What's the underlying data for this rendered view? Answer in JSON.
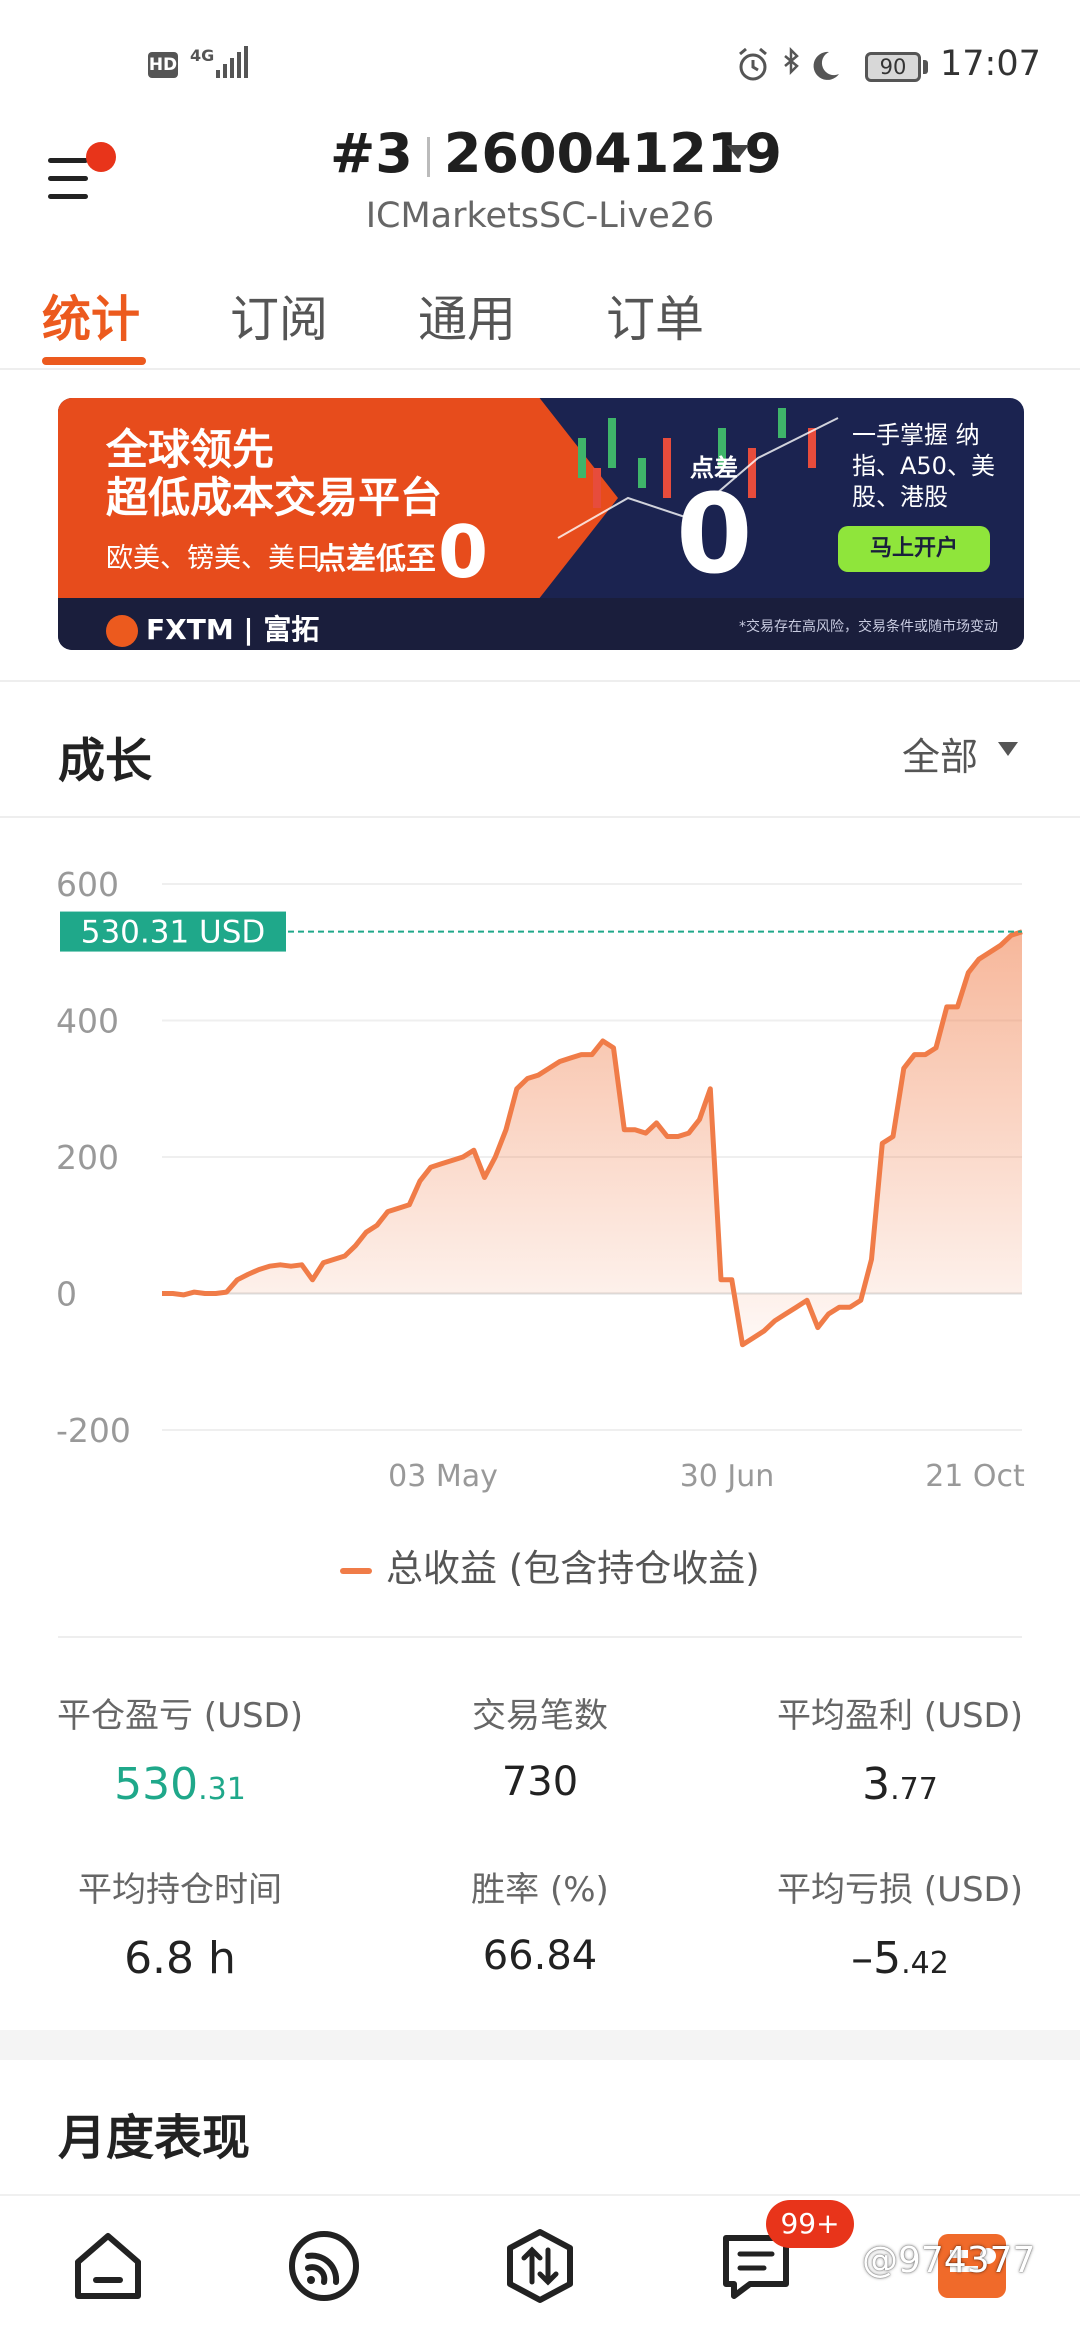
{
  "status_bar": {
    "hd": "HD",
    "network": "4G",
    "battery": "90",
    "time": "17:07"
  },
  "header": {
    "account_rank": "#3",
    "account_number": "260041219",
    "server": "ICMarketsSC-Live26"
  },
  "tabs": [
    {
      "label": "统计",
      "active": true
    },
    {
      "label": "订阅",
      "active": false
    },
    {
      "label": "通用",
      "active": false
    },
    {
      "label": "订单",
      "active": false
    }
  ],
  "banner": {
    "headline1": "全球领先",
    "headline2": "超低成本交易平台",
    "subline": "欧美、镑美、美日",
    "subline2": "点差低至",
    "zero": "0",
    "spread_label": "点差",
    "spread_zero": "0",
    "right_text": "一手掌握 纳指、A50、美股、港股",
    "cta": "马上开户",
    "brand": "FXTM | 富拓",
    "disclaimer": "*交易存在高风险，交易条件或随市场变动",
    "colors": {
      "red": "#e74c1c",
      "navy": "#1b2350",
      "cta": "#8fe53b"
    }
  },
  "growth": {
    "title": "成长",
    "filter": "全部",
    "current_value_label": "530.31 USD",
    "legend": "总收益 (包含持仓收益)"
  },
  "chart_data": {
    "type": "area",
    "title": "",
    "xlabel": "",
    "ylabel": "",
    "ylim": [
      -200,
      600
    ],
    "yticks": [
      "600",
      "400",
      "200",
      "0",
      "-200"
    ],
    "xticks": [
      "03 May",
      "30 Jun",
      "21 Oct"
    ],
    "grid": true,
    "line_color": "#f07c48",
    "marker_color": "#1fa88a",
    "current_value": 530.31,
    "series": [
      {
        "name": "总收益 (包含持仓收益)",
        "values": [
          0,
          0,
          -2,
          2,
          0,
          0,
          2,
          20,
          28,
          35,
          40,
          42,
          40,
          42,
          20,
          45,
          50,
          55,
          70,
          90,
          100,
          120,
          125,
          130,
          165,
          185,
          190,
          195,
          200,
          210,
          170,
          200,
          240,
          300,
          315,
          320,
          330,
          340,
          345,
          350,
          350,
          370,
          360,
          240,
          240,
          235,
          250,
          230,
          230,
          235,
          255,
          300,
          20,
          20,
          -75,
          -65,
          -55,
          -40,
          -30,
          -20,
          -10,
          -50,
          -30,
          -20,
          -20,
          -10,
          50,
          220,
          230,
          330,
          350,
          350,
          360,
          420,
          420,
          470,
          490,
          500,
          510,
          525,
          530
        ]
      }
    ]
  },
  "stats": [
    {
      "label": "平仓盈亏 (USD)",
      "value_int": "530",
      "value_dec": ".31",
      "color": "#1fa88a"
    },
    {
      "label": "交易笔数",
      "value_int": "730",
      "value_dec": ""
    },
    {
      "label": "平均盈利 (USD)",
      "value_int": "3",
      "value_dec": ".77"
    },
    {
      "label": "平均持仓时间",
      "value_int": "6.8 h",
      "value_dec": ""
    },
    {
      "label": "胜率 (%)",
      "value_int": "66.84",
      "value_dec": ""
    },
    {
      "label": "平均亏损 (USD)",
      "value_int": "–5",
      "value_dec": ".42"
    }
  ],
  "monthly": {
    "title": "月度表现"
  },
  "bottom_nav": {
    "items": [
      "home-icon",
      "signal-icon",
      "trade-icon",
      "messages-icon",
      "profile-icon"
    ],
    "badge": "99+"
  },
  "watermark": "@974377"
}
